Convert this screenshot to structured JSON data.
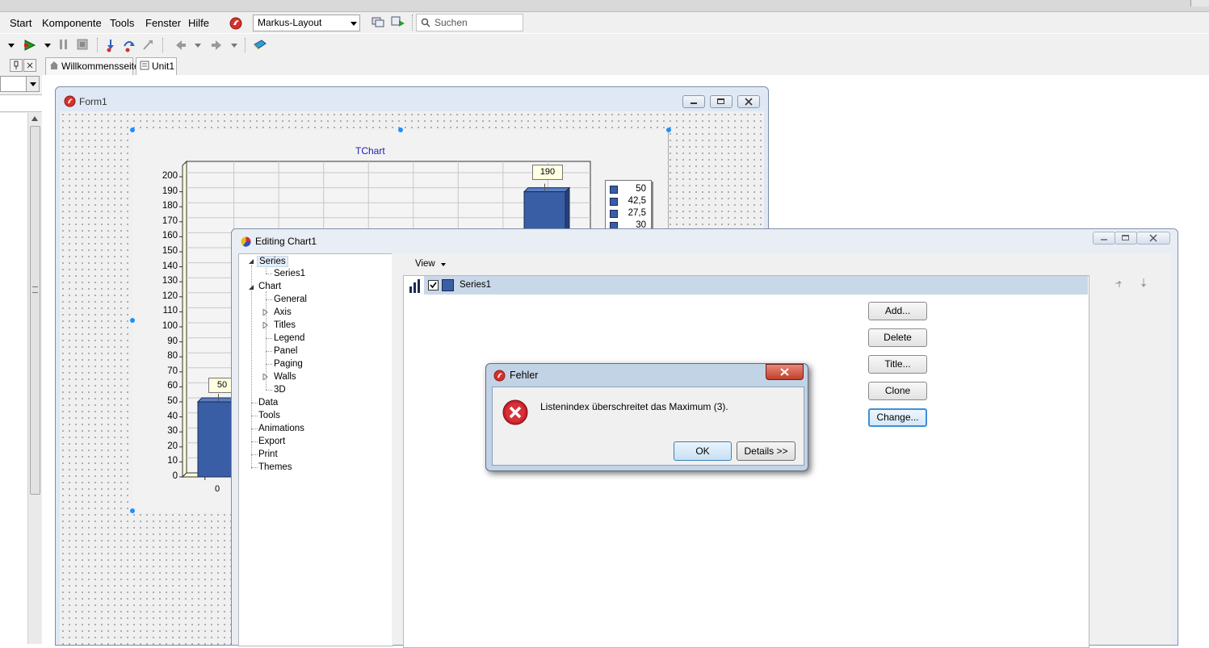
{
  "menubar": {
    "items": [
      "Start",
      "Komponente",
      "Tools",
      "Fenster",
      "Hilfe"
    ],
    "layout_combo": "Markus-Layout",
    "search_placeholder": "Suchen"
  },
  "tabs": [
    {
      "label": "Willkommensseite"
    },
    {
      "label": "Unit1"
    }
  ],
  "form1": {
    "title": "Form1"
  },
  "chart": {
    "title": "TChart",
    "bar_labels": [
      "50",
      "190"
    ],
    "x_tick": "0",
    "legend": [
      "50",
      "42,5",
      "27,5",
      "30"
    ]
  },
  "chart_data": {
    "type": "bar",
    "title": "TChart",
    "categories": [
      "0",
      "",
      "",
      "",
      "",
      "",
      "",
      "",
      ""
    ],
    "series": [
      {
        "name": "Series1",
        "values": [
          50,
          null,
          null,
          null,
          null,
          null,
          null,
          null,
          190
        ]
      }
    ],
    "yticks": [
      0,
      10,
      20,
      30,
      40,
      50,
      60,
      70,
      80,
      90,
      100,
      110,
      120,
      130,
      140,
      150,
      160,
      170,
      180,
      190,
      200
    ],
    "ylim": [
      0,
      200
    ],
    "grid": true,
    "legend_values": [
      "50",
      "42,5",
      "27,5",
      "30"
    ],
    "legend_position": "right"
  },
  "editor": {
    "title": "Editing Chart1",
    "tree": {
      "series": "Series",
      "series1": "Series1",
      "chart": "Chart",
      "general": "General",
      "axis": "Axis",
      "titles": "Titles",
      "legend": "Legend",
      "panel": "Panel",
      "paging": "Paging",
      "walls": "Walls",
      "threed": "3D",
      "data": "Data",
      "tools": "Tools",
      "animations": "Animations",
      "export": "Export",
      "print": "Print",
      "themes": "Themes"
    },
    "view_label": "View",
    "series_row": "Series1",
    "buttons": {
      "add": "Add...",
      "delete": "Delete",
      "title": "Title...",
      "clone": "Clone",
      "change": "Change..."
    }
  },
  "error_dialog": {
    "title": "Fehler",
    "message": "Listenindex überschreitet das Maximum (3).",
    "ok": "OK",
    "details": "Details >>"
  },
  "colors": {
    "bar": "#3a5ea5",
    "chart_title": "#2020b0",
    "selection": "#c8d8e8"
  }
}
